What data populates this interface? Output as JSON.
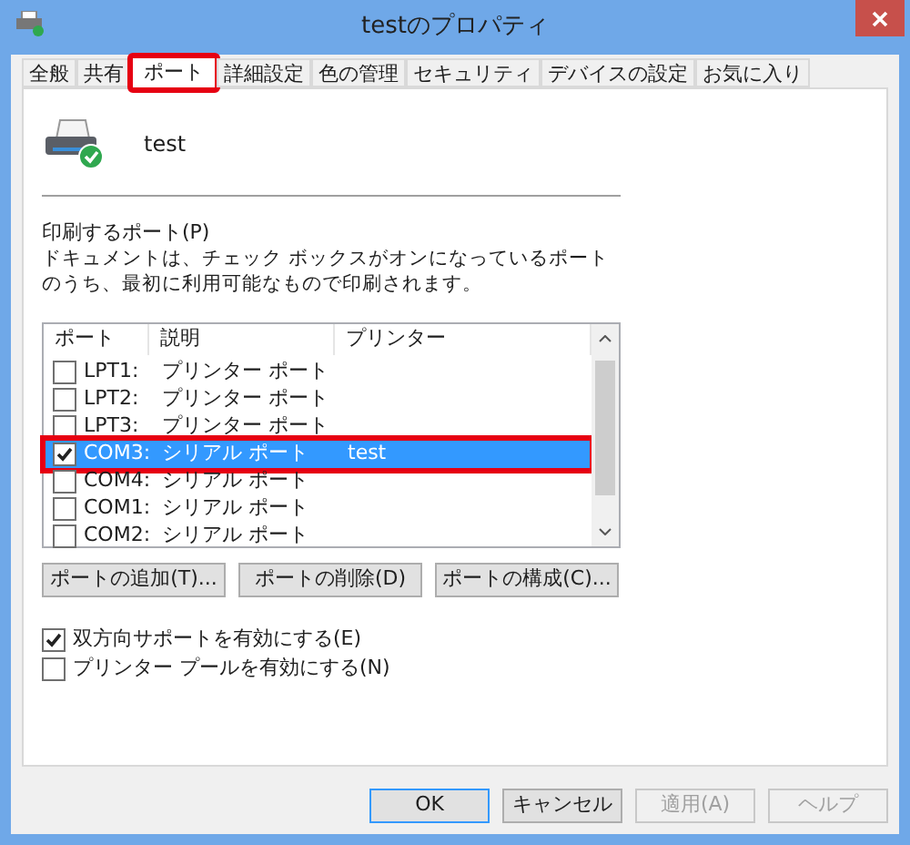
{
  "window": {
    "title": "testのプロパティ"
  },
  "tabs": [
    {
      "label": "全般",
      "selected": false,
      "highlighted": false
    },
    {
      "label": "共有",
      "selected": false,
      "highlighted": false
    },
    {
      "label": "ポート",
      "selected": true,
      "highlighted": true
    },
    {
      "label": "詳細設定",
      "selected": false,
      "highlighted": false
    },
    {
      "label": "色の管理",
      "selected": false,
      "highlighted": false
    },
    {
      "label": "セキュリティ",
      "selected": false,
      "highlighted": false
    },
    {
      "label": "デバイスの設定",
      "selected": false,
      "highlighted": false
    },
    {
      "label": "お気に入り",
      "selected": false,
      "highlighted": false
    }
  ],
  "printer_name": "test",
  "ports_label": "印刷するポート(P)",
  "ports_description": "ドキュメントは、チェック ボックスがオンになっているポートのうち、最初に利用可能なもので印刷されます。",
  "port_list": {
    "columns": [
      "ポート",
      "説明",
      "プリンター"
    ],
    "rows": [
      {
        "port": "LPT1:",
        "description": "プリンター ポート",
        "checked": false,
        "selected": false,
        "highlighted": false
      },
      {
        "port": "LPT2:",
        "description": "プリンター ポート",
        "checked": false,
        "selected": false,
        "highlighted": false
      },
      {
        "port": "LPT3:",
        "description": "プリンター ポート",
        "checked": false,
        "selected": false,
        "highlighted": false
      },
      {
        "port": "COM3:",
        "description": "シリアル ポート",
        "printer": "test",
        "checked": true,
        "selected": true,
        "highlighted": true
      },
      {
        "port": "COM4:",
        "description": "シリアル ポート",
        "checked": false,
        "selected": false,
        "highlighted": false
      },
      {
        "port": "COM1:",
        "description": "シリアル ポート",
        "checked": false,
        "selected": false,
        "highlighted": false
      },
      {
        "port": "COM2:",
        "description": "シリアル ポート",
        "checked": false,
        "selected": false,
        "highlighted": false
      }
    ]
  },
  "port_buttons": [
    "ポートの追加(T)...",
    "ポートの削除(D)",
    "ポートの構成(C)..."
  ],
  "options": [
    {
      "label": "双方向サポートを有効にする(E)",
      "checked": true
    },
    {
      "label": "プリンター プールを有効にする(N)",
      "checked": false
    }
  ],
  "dialog_buttons": [
    {
      "label": "OK",
      "disabled": false,
      "default": true
    },
    {
      "label": "キャンセル",
      "disabled": false,
      "default": false
    },
    {
      "label": "適用(A)",
      "disabled": true,
      "default": false
    },
    {
      "label": "ヘルプ",
      "disabled": true,
      "default": false
    }
  ]
}
